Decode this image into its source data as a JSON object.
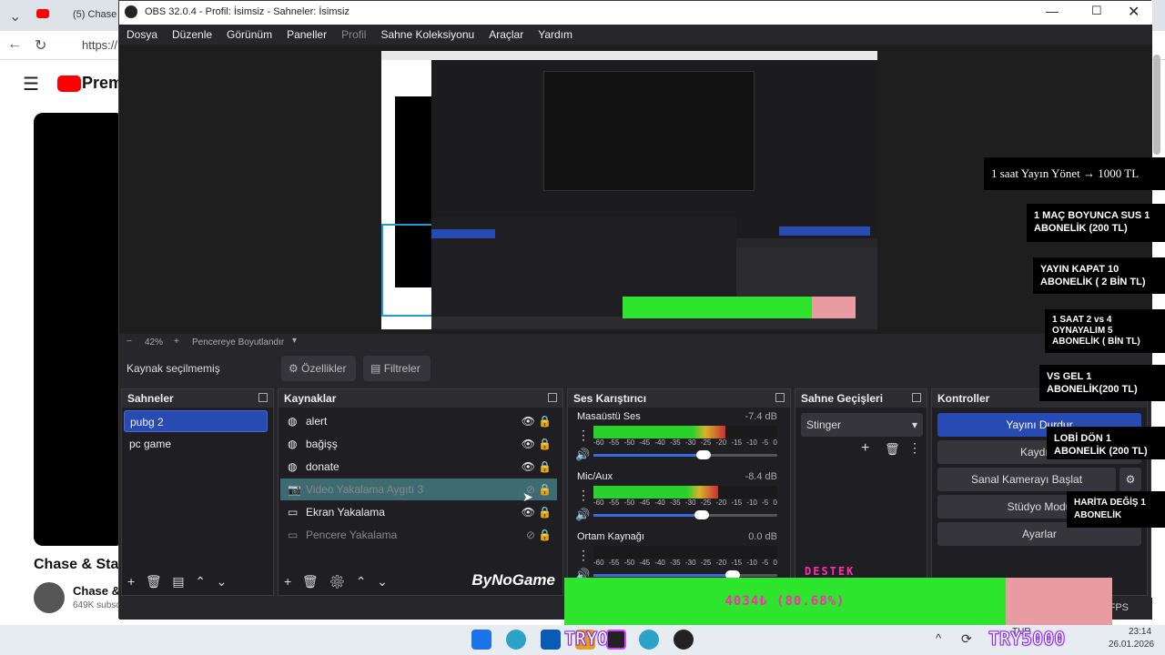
{
  "browser": {
    "tab_label": "(5) Chase &",
    "address": "https://",
    "logo_text": "Premi",
    "video_title": "Chase & Stat",
    "channel": "Chase &",
    "subs": "649K subsc"
  },
  "obs": {
    "title": "OBS 32.0.4 - Profil: İsimsiz - Sahneler: İsimsiz",
    "menu": [
      "Dosya",
      "Düzenle",
      "Görünüm",
      "Paneller",
      "Profil",
      "Sahne Koleksiyonu",
      "Araçlar",
      "Yardım"
    ],
    "zoom": {
      "minus": "−",
      "value": "42%",
      "plus": "+",
      "fit": "Pencereye Boyutlandır"
    },
    "context": {
      "no_source": "Kaynak seçilmemiş",
      "properties": "Özellikler",
      "filters": "Filtreler"
    },
    "scenes": {
      "title": "Sahneler",
      "items": [
        "pubg 2",
        "pc game"
      ]
    },
    "sources": {
      "title": "Kaynaklar",
      "items": [
        "alert",
        "bağişş",
        "donate",
        "Video Yakalama Aygıtı 3",
        "Ekran Yakalama",
        "Pencere Yakalama"
      ],
      "brand": "ByNoGame"
    },
    "mixer": {
      "title": "Ses Karıştırıcı",
      "channels": [
        {
          "name": "Masaüstü Ses",
          "db": "-7.4 dB",
          "level": 0.72,
          "fader": 0.78
        },
        {
          "name": "Mic/Aux",
          "db": "-8.4 dB",
          "level": 0.68,
          "fader": 0.76
        },
        {
          "name": "Ortam Kaynağı",
          "db": "0.0 dB",
          "level": 0.0,
          "fader": 1.0
        }
      ],
      "scale": [
        "-60",
        "-55",
        "-50",
        "-45",
        "-40",
        "-35",
        "-30",
        "-25",
        "-20",
        "-15",
        "-10",
        "-5",
        "0"
      ]
    },
    "transitions": {
      "title": "Sahne Geçişleri",
      "selected": "Stinger"
    },
    "controls": {
      "title": "Kontroller",
      "buttons": [
        "Yayını Durdur",
        "Kaydı B",
        "Sanal Kamerayı Başlat",
        "Stüdyo Modu",
        "Ayarlar"
      ]
    },
    "status": {
      "fps": "FPS"
    }
  },
  "overlays": {
    "notes": [
      "1 saat Yayın Yönet → 1000 TL",
      "1 MAÇ BOYUNCA SUS 1 ABONELİK (200 TL)",
      "YAYIN KAPAT 10 ABONELİK ( 2 BİN TL)",
      "1 SAAT 2 vs 4 OYNAYALIM 5 ABONELİK ( BİN TL)",
      "VS GEL 1 ABONELİK(200 TL)",
      "LOBİ DÖN 1 ABONELİK (200 TL)",
      "HARİTA DEĞİŞ 1 ABONELİK"
    ],
    "destek": "DESTEK",
    "donation": "4034₺ (80.68%)",
    "try_left": "TRYO",
    "try_right": "TRY5000"
  },
  "taskbar": {
    "lang": "TUR",
    "time": "23:14",
    "date": "26.01.2026"
  }
}
